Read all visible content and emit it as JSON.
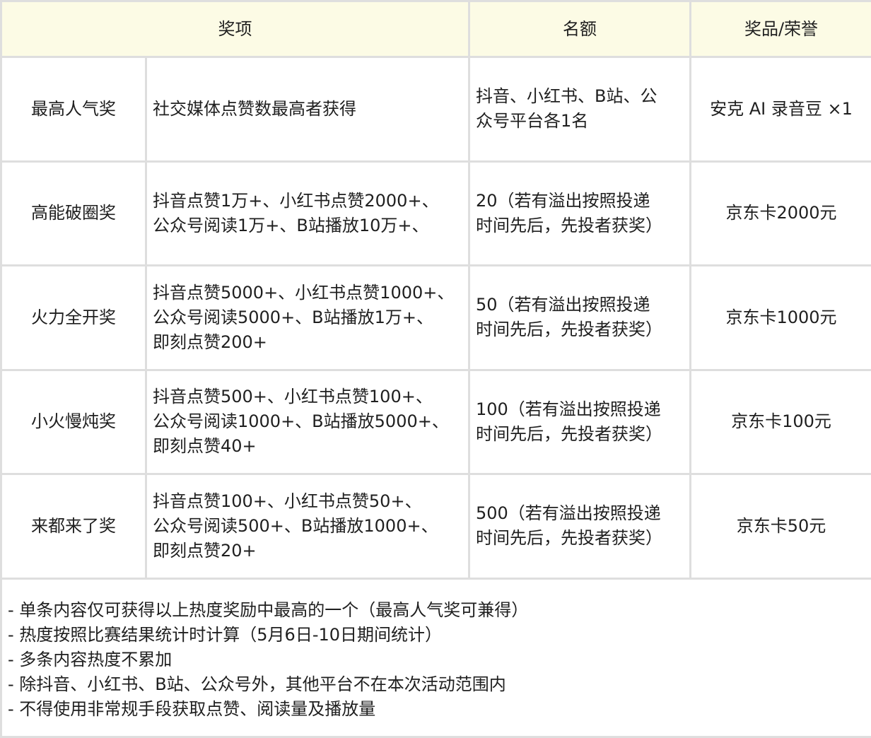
{
  "header": {
    "award": "奖项",
    "quota": "名额",
    "prize": "奖品/荣誉"
  },
  "rows": [
    {
      "name": "最高人气奖",
      "criteria": "社交媒体点赞数最高者获得",
      "quota": "抖音、小红书、B站、公\n众号平台各1名",
      "prize": "安克 AI 录音豆 ×1"
    },
    {
      "name": "高能破圈奖",
      "criteria": "抖音点赞1万+、小红书点赞2000+、\n公众号阅读1万+、B站播放10万+、",
      "quota": "20（若有溢出按照投递\n时间先后，先投者获奖）",
      "prize": "京东卡2000元"
    },
    {
      "name": "火力全开奖",
      "criteria": "抖音点赞5000+、小红书点赞1000+、\n公众号阅读5000+、B站播放1万+、\n即刻点赞200+",
      "quota": "50（若有溢出按照投递\n时间先后，先投者获奖）",
      "prize": "京东卡1000元"
    },
    {
      "name": "小火慢炖奖",
      "criteria": "抖音点赞500+、小红书点赞100+、\n公众号阅读1000+、B站播放5000+、\n即刻点赞40+",
      "quota": "100（若有溢出按照投递\n时间先后，先投者获奖）",
      "prize": "京东卡100元"
    },
    {
      "name": "来都来了奖",
      "criteria": "抖音点赞100+、小红书点赞50+、\n公众号阅读500+、B站播放1000+、\n即刻点赞20+",
      "quota": "500（若有溢出按照投递\n时间先后，先投者获奖）",
      "prize": "京东卡50元"
    }
  ],
  "notes": [
    "- 单条内容仅可获得以上热度奖励中最高的一个（最高人气奖可兼得）",
    "- 热度按照比赛结果统计时计算（5月6日-10日期间统计）",
    "- 多条内容热度不累加",
    "- 除抖音、小红书、B站、公众号外，其他平台不在本次活动范围内",
    "- 不得使用非常规手段获取点赞、阅读量及播放量"
  ]
}
